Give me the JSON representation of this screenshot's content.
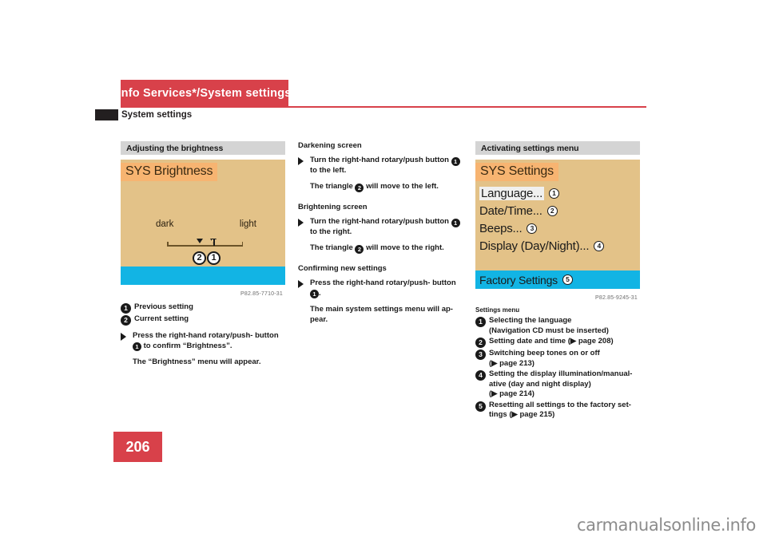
{
  "header": {
    "chapter_tab": "Info Services*/System settings",
    "section_title": "System settings"
  },
  "page_number": "206",
  "watermark": "carmanualsonline.info",
  "columns": {
    "left": {
      "caption": "Adjusting the brightness",
      "display": {
        "title": "SYS Brightness",
        "scale_low": "dark",
        "scale_high": "light",
        "marker_previous": "2",
        "marker_current": "1",
        "image_id": "P82.85-7710-31"
      },
      "legend": [
        {
          "num": "1",
          "text": "Previous setting"
        },
        {
          "num": "2",
          "text": "Current setting"
        }
      ],
      "step_text_a": "Press the right-hand rotary/push-",
      "step_text_b": "button",
      "step_num": "1",
      "step_text_c": "to confirm “Brightness”.",
      "result": "The “Brightness” menu will appear."
    },
    "middle": {
      "sections": [
        {
          "heading": "Darkening screen",
          "step_a": "Turn the right-hand rotary/push button",
          "step_num": "1",
          "step_b": "to the left.",
          "result_a": "The triangle",
          "result_num": "2",
          "result_b": "will move to the left."
        },
        {
          "heading": "Brightening screen",
          "step_a": "Turn the right-hand rotary/push button",
          "step_num": "1",
          "step_b": "to the right.",
          "result_a": "The triangle",
          "result_num": "2",
          "result_b": "will move to the right."
        },
        {
          "heading": "Confirming new settings",
          "step_a": "Press the right-hand rotary/push-",
          "step_b": "button",
          "step_num": "1",
          "step_c": ".",
          "result_a": "The main system settings menu will ap-",
          "result_b": "pear."
        }
      ]
    },
    "right": {
      "caption": "Activating settings menu",
      "display": {
        "title": "SYS Settings",
        "items": [
          {
            "label": "Language...",
            "num": "1",
            "highlight": true
          },
          {
            "label": "Date/Time...",
            "num": "2",
            "highlight": false
          },
          {
            "label": "Beeps...",
            "num": "3",
            "highlight": false
          },
          {
            "label": "Display (Day/Night)...",
            "num": "4",
            "highlight": false
          }
        ],
        "footer_item": {
          "label": "Factory Settings",
          "num": "5"
        },
        "image_id": "P82.85-9245-31"
      },
      "legend_head": "Settings menu",
      "legend": [
        {
          "num": "1",
          "lines": [
            "Selecting the language",
            "(Navigation CD must be inserted)"
          ]
        },
        {
          "num": "2",
          "lines": [
            "Setting date and time (▶ page 208)"
          ]
        },
        {
          "num": "3",
          "lines": [
            "Switching beep tones on or off",
            "(▶ page 213)"
          ]
        },
        {
          "num": "4",
          "lines": [
            "Setting the display illumination/manual-",
            "ative (day and night display)",
            "(▶ page 214)"
          ]
        },
        {
          "num": "5",
          "lines": [
            "Resetting all settings to the factory set-",
            "tings (▶ page 215)"
          ]
        }
      ]
    }
  }
}
